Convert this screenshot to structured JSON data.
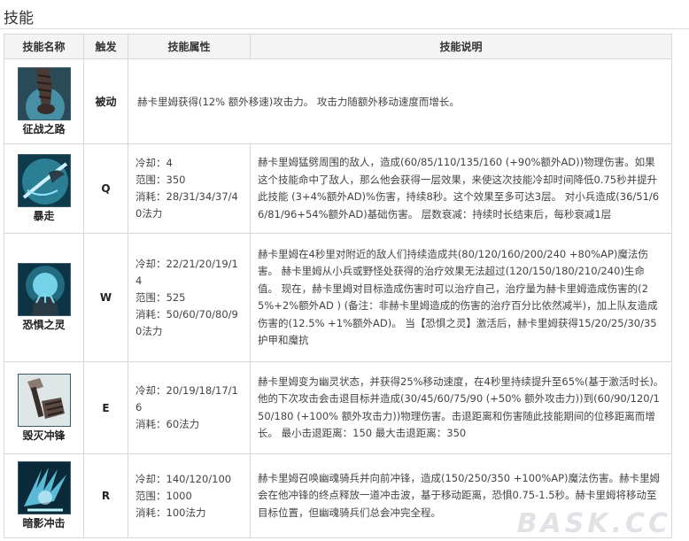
{
  "section_title": "技能",
  "headers": {
    "name": "技能名称",
    "trigger": "触发",
    "attributes": "技能属性",
    "description": "技能说明"
  },
  "skills": [
    {
      "name": "征战之路",
      "trigger": "被动",
      "icon": "passive-arm-icon",
      "description": "赫卡里姆获得(12% 额外移速)攻击力。 攻击力随额外移动速度而增长。"
    },
    {
      "name": "暴走",
      "trigger": "Q",
      "icon": "rampage-blade-icon",
      "attr1": "冷却：4",
      "attr2": "范围：350",
      "attr3": "消耗：28/31/34/37/40法力",
      "description": "赫卡里姆猛劈周围的敌人，造成(60/85/110/135/160 (+90%额外AD))物理伤害。如果这个技能命中了敌人，那么他会获得一层效果，来使这次技能冷却时间降低0.75秒并提升此技能 (3+4%额外AD)%伤害，持续8秒。这个效果至多可达3层。 对小兵造成(36/51/66/81/96+54%额外AD)基础伤害。 层数衰减：持续时长结束后，每秒衰减1层"
    },
    {
      "name": "恐惧之灵",
      "trigger": "W",
      "icon": "spirit-of-dread-icon",
      "attr1": "冷却：22/21/20/19/14",
      "attr2": "范围：525",
      "attr3": "消耗：50/60/70/80/90法力",
      "description": "赫卡里姆在4秒里对附近的敌人们持续造成共(80/120/160/200/240 +80%AP)魔法伤害。 赫卡里姆从小兵或野怪处获得的治疗效果无法超过(120/150/180/210/240)生命值。 现在，赫卡里姆对目标造成伤害时可以治疗自己，治疗量为赫卡里姆造成伤害的(25%+2%额外AD ) (备注：非赫卡里姆造成的伤害的治疗百分比依然减半)，加上队友造成伤害的(12.5% +1%额外AD)。 当【恐惧之灵】激活后，赫卡里姆获得15/20/25/30/35护甲和魔抗"
    },
    {
      "name": "毁灭冲锋",
      "trigger": "E",
      "icon": "devastating-charge-icon",
      "attr1": "冷却：20/19/18/17/16",
      "attr2": "消耗：60法力",
      "attr3": "",
      "description": "赫卡里姆变为幽灵状态，并获得25%移动速度，在4秒里持续提升至65%(基于激活时长)。他的下次攻击会击退目标并造成(30/45/60/75/90 (+50% 额外攻击力))到(60/90/120/150/180 (+100% 额外攻击力))物理伤害。击退距离和伤害随此技能期间的位移距离而增长。 最小击退距离：150 最大击退距离：350"
    },
    {
      "name": "暗影冲击",
      "trigger": "R",
      "icon": "onslaught-of-shadows-icon",
      "attr1": "冷却：140/120/100",
      "attr2": "范围：1000",
      "attr3": "消耗：100法力",
      "description": "赫卡里姆召唤幽魂骑兵并向前冲锋，造成(150/250/350 +100%AP)魔法伤害。赫卡里姆会在他冲锋的终点释放一道冲击波，基于移动距离，恐惧0.75-1.5秒。赫卡里姆将移动至目标位置，但幽魂骑兵们总会冲完全程。"
    }
  ],
  "watermark": "BASK.CC"
}
